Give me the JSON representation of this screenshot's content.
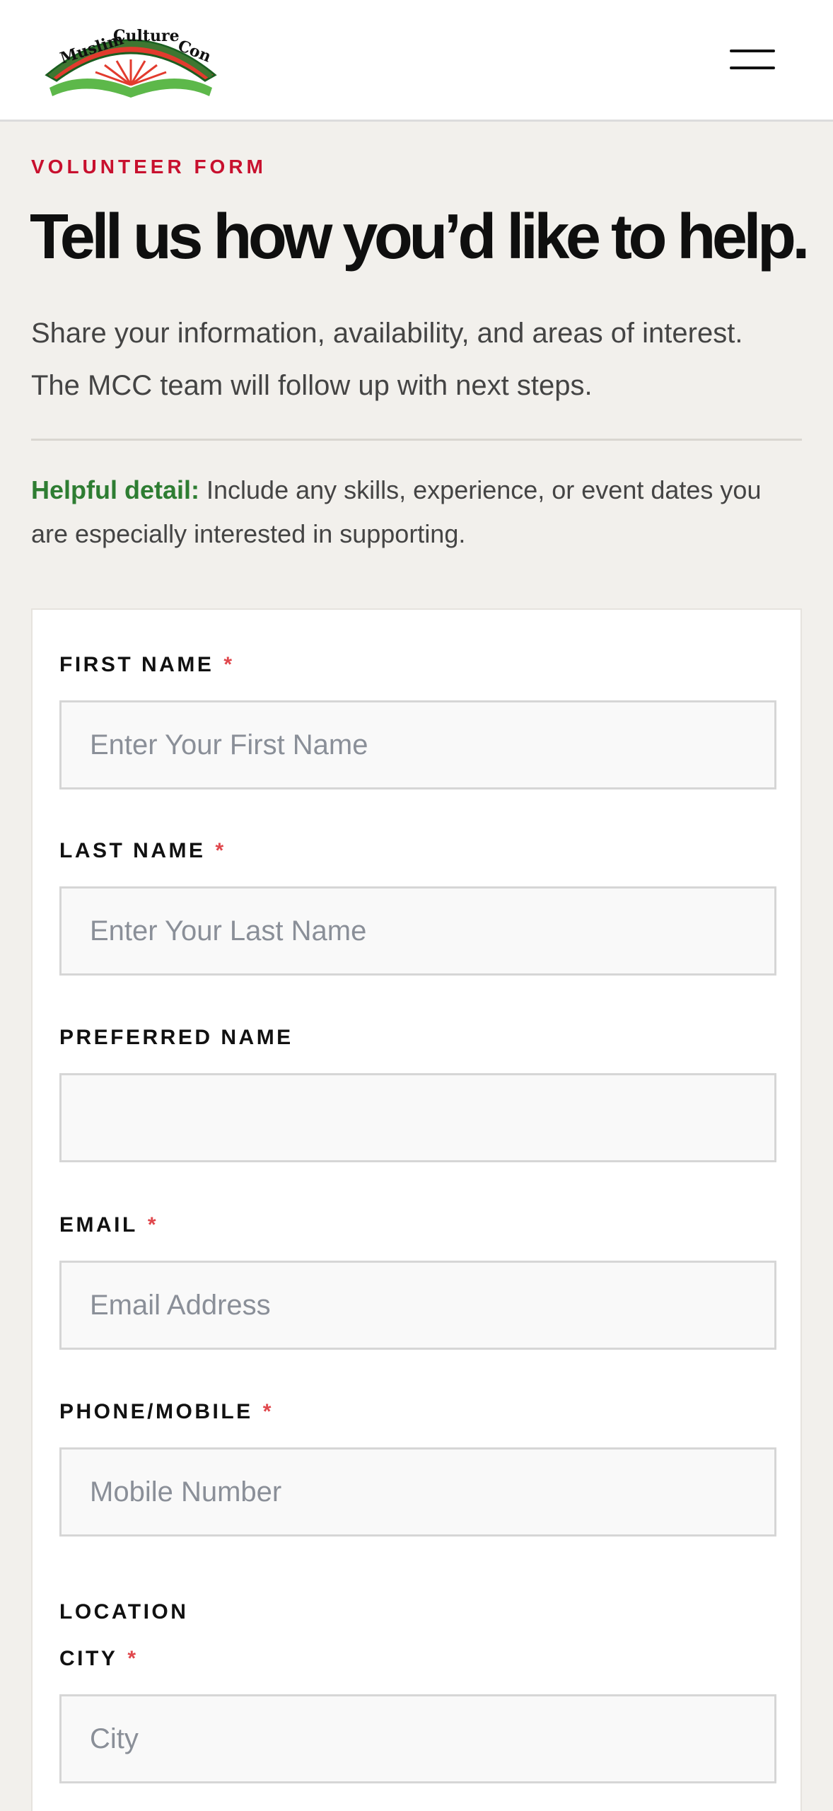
{
  "header": {
    "logo_text": "Muslim Culture Con",
    "menu_icon": "hamburger-menu-icon"
  },
  "intro": {
    "eyebrow": "VOLUNTEER FORM",
    "headline": "Tell us how you’d like to help.",
    "description": "Share your information, availability, and areas of interest. The MCC team will follow up with next steps.",
    "detail_lead": "Helpful detail:",
    "detail_text": " Include any skills, experience, or event dates you are especially interested in supporting."
  },
  "form": {
    "required_marker": "*",
    "first_name": {
      "label": "FIRST NAME",
      "placeholder": "Enter Your First Name",
      "value": ""
    },
    "last_name": {
      "label": "LAST NAME",
      "placeholder": "Enter Your Last Name",
      "value": ""
    },
    "preferred_name": {
      "label": "PREFERRED NAME",
      "placeholder": "",
      "value": ""
    },
    "email": {
      "label": "EMAIL",
      "placeholder": "Email Address",
      "value": ""
    },
    "phone": {
      "label": "PHONE/MOBILE",
      "placeholder": "Mobile Number",
      "value": ""
    },
    "location_heading": "LOCATION",
    "city": {
      "label": "CITY",
      "placeholder": "City",
      "value": ""
    }
  },
  "colors": {
    "accent_red": "#c8102e",
    "accent_green": "#2e7d32",
    "required_red": "#e0474c",
    "page_bg": "#f2f0ec"
  }
}
